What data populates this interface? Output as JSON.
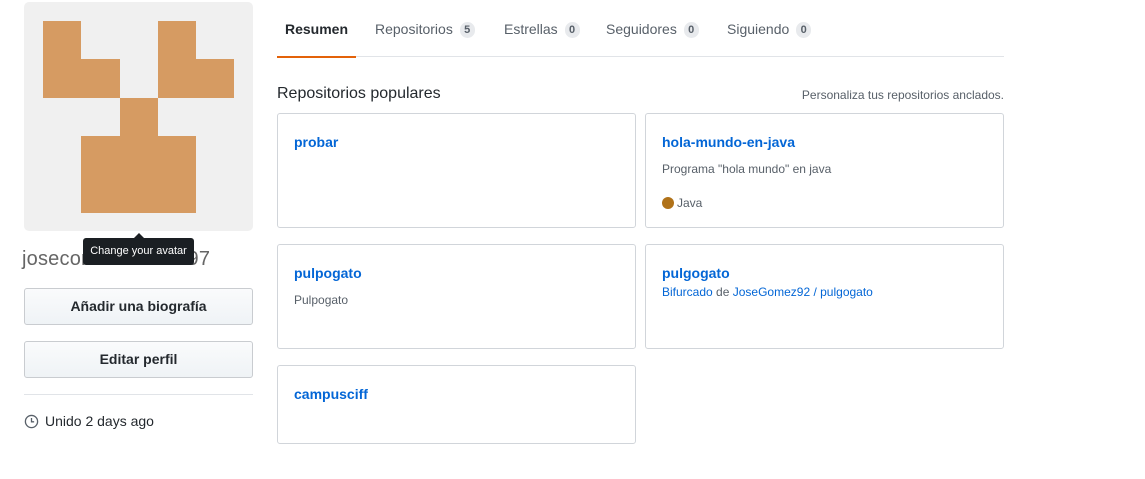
{
  "profile": {
    "avatar_tooltip": "Change your avatar",
    "username": "josecordonescobo97",
    "bio_button": "Añadir una biografía",
    "edit_button": "Editar perfil",
    "joined": "Unido 2 days ago",
    "avatar_color": "#d69b62"
  },
  "tabs": [
    {
      "label": "Resumen",
      "count": null,
      "selected": true
    },
    {
      "label": "Repositorios",
      "count": "5",
      "selected": false
    },
    {
      "label": "Estrellas",
      "count": "0",
      "selected": false
    },
    {
      "label": "Seguidores",
      "count": "0",
      "selected": false
    },
    {
      "label": "Siguiendo",
      "count": "0",
      "selected": false
    }
  ],
  "pinned": {
    "title": "Repositorios populares",
    "customize_link": "Personaliza tus repositorios anclados.",
    "repos": [
      {
        "name": "probar"
      },
      {
        "name": "hola-mundo-en-java",
        "description": "Programa \"hola mundo\" en java",
        "language": "Java",
        "language_color": "#b07219"
      },
      {
        "name": "pulpogato",
        "description": "Pulpogato"
      },
      {
        "name": "pulgogato",
        "fork_prefix": "Bifurcado",
        "fork_of": "de",
        "fork_source": "JoseGomez92 / pulgogato"
      },
      {
        "name": "campusciff"
      }
    ]
  }
}
